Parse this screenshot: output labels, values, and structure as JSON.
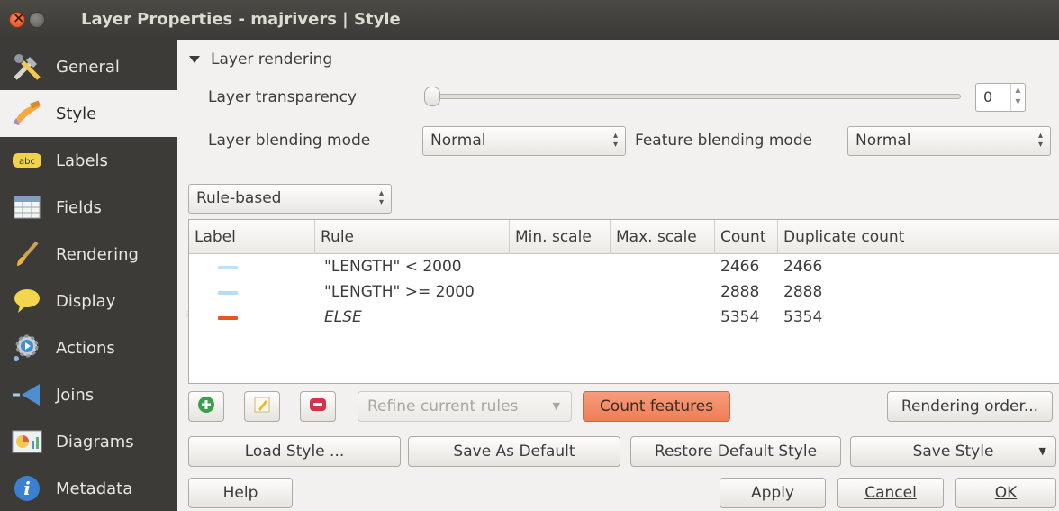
{
  "window": {
    "title": "Layer Properties - majrivers | Style"
  },
  "sidebar": {
    "items": [
      {
        "label": "General",
        "icon": "tools-icon"
      },
      {
        "label": "Style",
        "icon": "paintbrush-icon"
      },
      {
        "label": "Labels",
        "icon": "abc-label-icon"
      },
      {
        "label": "Fields",
        "icon": "table-icon"
      },
      {
        "label": "Rendering",
        "icon": "brush-icon"
      },
      {
        "label": "Display",
        "icon": "speech-bubble-icon"
      },
      {
        "label": "Actions",
        "icon": "gear-play-icon"
      },
      {
        "label": "Joins",
        "icon": "join-arrow-icon"
      },
      {
        "label": "Diagrams",
        "icon": "diagram-icon"
      },
      {
        "label": "Metadata",
        "icon": "info-icon"
      }
    ],
    "active": "Style"
  },
  "layer_rendering": {
    "title": "Layer rendering",
    "transparency_label": "Layer transparency",
    "transparency_value": "0",
    "blending_label": "Layer blending mode",
    "blending_value": "Normal",
    "feature_blending_label": "Feature blending mode",
    "feature_blending_value": "Normal"
  },
  "renderer": {
    "value": "Rule-based"
  },
  "rules_table": {
    "columns": [
      "Label",
      "Rule",
      "Min. scale",
      "Max. scale",
      "Count",
      "Duplicate count"
    ],
    "rows": [
      {
        "rule": "\"LENGTH\"  < 2000",
        "min": "",
        "max": "",
        "count": "2466",
        "dup": "2466",
        "color": "#bfe0f5",
        "italic": false
      },
      {
        "rule": "\"LENGTH\" >= 2000",
        "min": "",
        "max": "",
        "count": "2888",
        "dup": "2888",
        "color": "#b8dcf4",
        "italic": false
      },
      {
        "rule": "ELSE",
        "min": "",
        "max": "",
        "count": "5354",
        "dup": "5354",
        "color": "#e8561d",
        "italic": true
      }
    ]
  },
  "toolbar": {
    "refine_label": "Refine current rules",
    "count_label": "Count features",
    "rendering_order_label": "Rendering order..."
  },
  "style_buttons": {
    "load": "Load Style ...",
    "save_default": "Save As Default",
    "restore_default": "Restore Default Style",
    "save_style": "Save Style"
  },
  "dialog_buttons": {
    "help": "Help",
    "apply": "Apply",
    "cancel": "Cancel",
    "ok": "OK"
  },
  "colors": {
    "accent": "#f07d55",
    "sidebar_bg": "#3c3b37",
    "titlebar_bg": "#3b3a36"
  }
}
